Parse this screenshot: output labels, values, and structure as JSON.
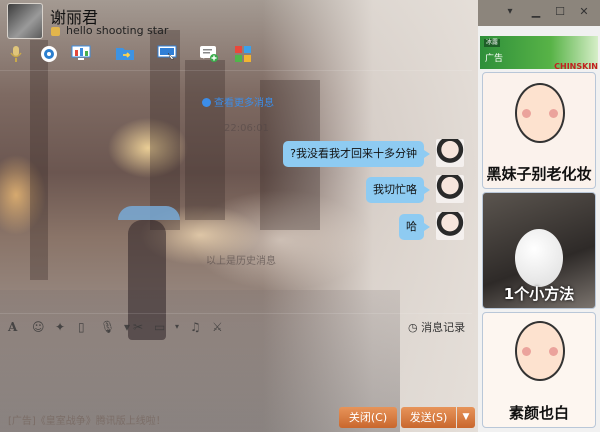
{
  "window": {
    "minimize": "▁",
    "maximize": "☐",
    "close": "✕",
    "menu": "▾"
  },
  "contact": {
    "name": "谢丽君",
    "signature": "hello shooting star"
  },
  "toolbar": {
    "icons": [
      "microphone-icon",
      "camera-icon",
      "screen-share-icon",
      "folder-transfer-icon",
      "remote-assist-icon",
      "add-app-icon",
      "apps-grid-icon"
    ]
  },
  "messages": {
    "more_link": "查看更多消息",
    "timestamp": "22:06:01",
    "items": [
      {
        "text": "?我没看我才回来十多分钟"
      },
      {
        "text": "我切忙咯"
      },
      {
        "text": "哈"
      }
    ],
    "history_label": "以上是历史消息"
  },
  "input_toolbar": {
    "history": "消息记录"
  },
  "footer": {
    "ad": "[广告]《皇室战争》腾讯版上线啦！",
    "close": "关闭(C)",
    "send": "发送(S)"
  },
  "sidebar": {
    "ad_label": "广告",
    "ad_logo": "冰露",
    "ad_brand": "CHINSKIN",
    "cards": [
      "黑妹子别老化妆",
      "1个小方法",
      "素颜也白"
    ]
  },
  "colors": {
    "bubble": "#8ecbf2",
    "link": "#3c8de8",
    "button": "#d9773d"
  }
}
